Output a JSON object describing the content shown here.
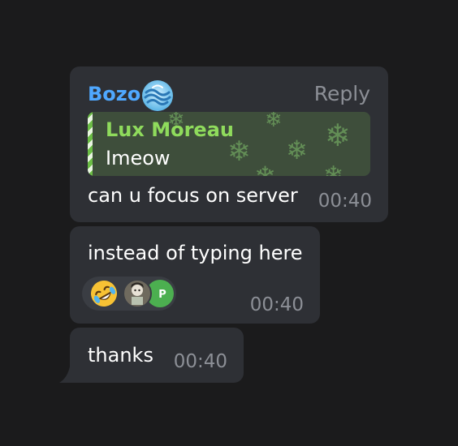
{
  "messages": [
    {
      "sender": "Bozo",
      "reply_label": "Reply",
      "quote": {
        "author": "Lux Moreau",
        "text": "Imeow"
      },
      "text": "can u focus on server",
      "time": "00:40"
    },
    {
      "text": "instead of typing here",
      "time": "00:40",
      "reactions": {
        "emoji": "rolling-on-floor-laughing",
        "avatar_badge": "P"
      }
    },
    {
      "text": "thanks",
      "time": "00:40"
    }
  ],
  "colors": {
    "background": "#1b1b1c",
    "bubble": "#2e3035",
    "sender_name": "#4fa8ff",
    "quote_author": "#8fdb5c",
    "quote_background": "#3e4e3b",
    "timestamp": "#8c8f96"
  }
}
